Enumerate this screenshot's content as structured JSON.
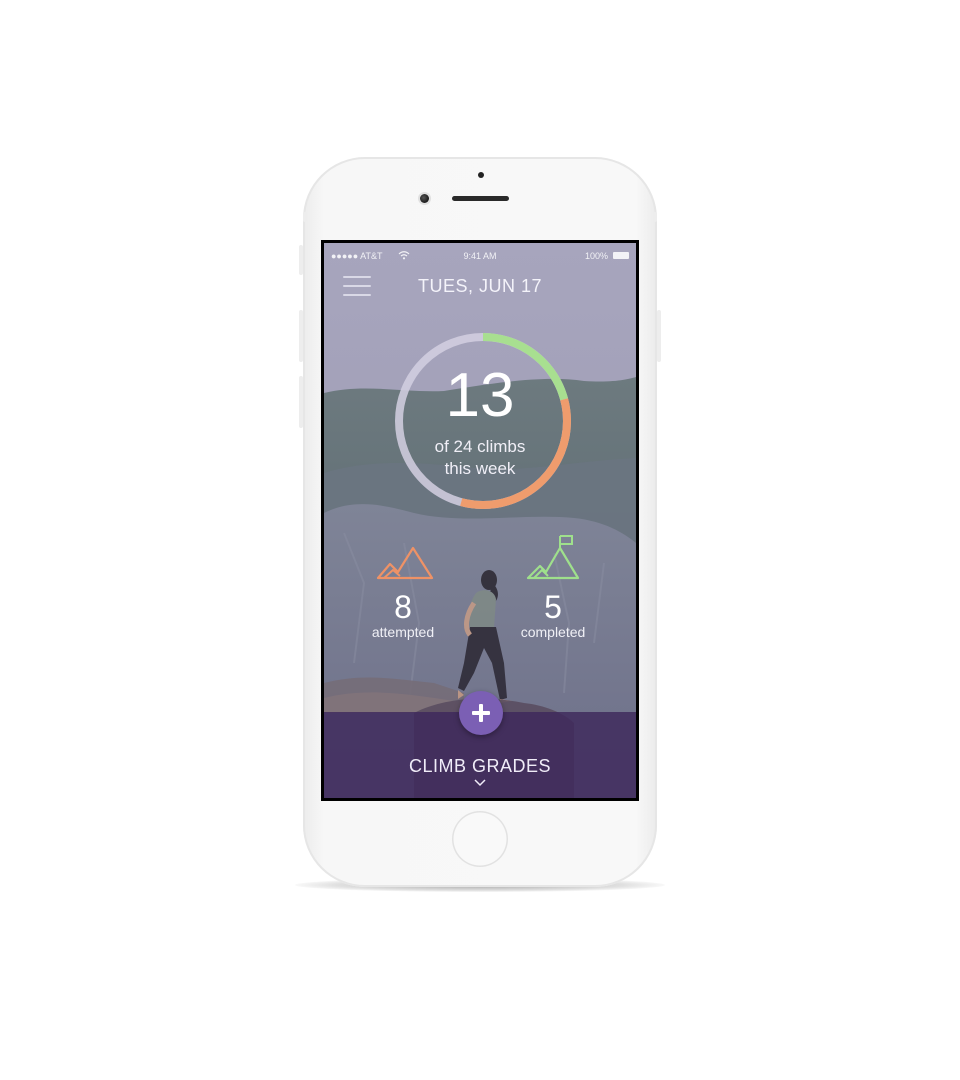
{
  "status_bar": {
    "carrier": "●●●●● AT&T",
    "time": "9:41 AM",
    "battery": "100%"
  },
  "header": {
    "menu_icon": "hamburger-menu-icon",
    "date": "TUES, JUN 17"
  },
  "progress": {
    "count": "13",
    "subtitle_line1": "of 24 climbs",
    "subtitle_line2": "this week",
    "completed_fraction": 0.2083,
    "attempted_fraction": 0.3333,
    "colors": {
      "completed": "#a8df90",
      "attempted": "#ef9c6d",
      "track": "#d4d0e2"
    }
  },
  "stats": {
    "attempted": {
      "icon": "mountain-icon",
      "value": "8",
      "label": "attempted",
      "color": "#ef9266"
    },
    "completed": {
      "icon": "mountain-flag-icon",
      "value": "5",
      "label": "completed",
      "color": "#9fe08c"
    }
  },
  "actions": {
    "add_icon": "plus-icon"
  },
  "bottom": {
    "label": "CLIMB GRADES",
    "chevron_icon": "chevron-down-icon"
  },
  "colors": {
    "accent": "#7b5fb4",
    "bottom_bar": "#3e285c"
  }
}
